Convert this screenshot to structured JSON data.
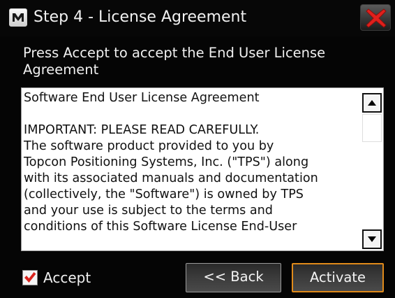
{
  "window": {
    "title": "Step 4 - License Agreement"
  },
  "prompt": "Press Accept to accept the End User License Agreement",
  "eula": {
    "heading": "Software End User License Agreement",
    "lines": [
      "IMPORTANT:  PLEASE READ CAREFULLY.",
      "The software product provided to you  by",
      "Topcon Positioning Systems, Inc. (\"TPS\") along",
      "with its associated manuals and documentation",
      "(collectively, the \"Software\") is owned by TPS",
      "and your use is subject to the terms and",
      "conditions of this Software License End-User"
    ]
  },
  "accept": {
    "label": "Accept",
    "checked": true
  },
  "buttons": {
    "back": "<< Back",
    "activate": "Activate"
  },
  "colors": {
    "accent": "#e08a1a",
    "close_red": "#e0201c",
    "check_red": "#d9241e"
  },
  "icons": {
    "app": "app-logo-icon",
    "close": "close-x-icon",
    "scroll_up": "arrow-up-icon",
    "scroll_down": "arrow-down-icon",
    "check": "checkmark-icon"
  }
}
